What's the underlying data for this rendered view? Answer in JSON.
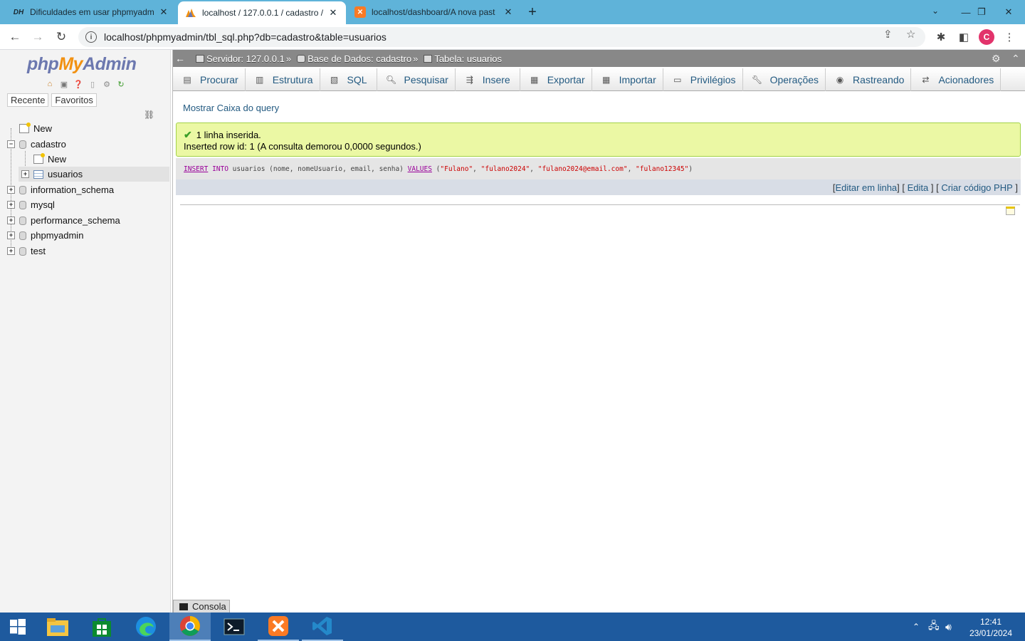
{
  "browser": {
    "tabs": [
      {
        "title": "Dificuldades em usar phpmyadm",
        "favicon": "DH",
        "active": false
      },
      {
        "title": "localhost / 127.0.0.1 / cadastro /",
        "favicon": "pma-icon",
        "active": true
      },
      {
        "title": "localhost/dashboard/A nova past",
        "favicon": "xampp-icon",
        "active": false
      }
    ],
    "url": "localhost/phpmyadmin/tbl_sql.php?db=cadastro&table=usuarios",
    "profile_initial": "C"
  },
  "pma": {
    "logo": {
      "php": "php",
      "my": "My",
      "admin": "Admin"
    },
    "left_tabs": [
      "Recente",
      "Favoritos"
    ],
    "tree": {
      "new_root": "New",
      "cadastro": "cadastro",
      "cadastro_new": "New",
      "usuarios": "usuarios",
      "information_schema": "information_schema",
      "mysql": "mysql",
      "performance_schema": "performance_schema",
      "phpmyadmin": "phpmyadmin",
      "test": "test"
    },
    "breadcrumb": {
      "server": "Servidor: 127.0.0.1",
      "database": "Base de Dados: cadastro",
      "table": "Tabela: usuarios"
    },
    "menu": [
      "Procurar",
      "Estrutura",
      "SQL",
      "Pesquisar",
      "Insere",
      "Exportar",
      "Importar",
      "Privilégios",
      "Operações",
      "Rastreando",
      "Acionadores"
    ],
    "show_query_box": "Mostrar Caixa do query",
    "success": {
      "line1": "1 linha inserida.",
      "line2": "Inserted row id: 1 (A consulta demorou 0,0000 segundos.)"
    },
    "sql": {
      "insert": "INSERT",
      "into": "INTO",
      "table_cols": " usuarios (nome, nomeUsuario, email, senha) ",
      "values": "VALUES",
      "open": " (",
      "v1": "\"Fulano\"",
      "v2": "\"fulano2024\"",
      "v3": "\"fulano2024@email.com\"",
      "v4": "\"fulano12345\"",
      "close": ")"
    },
    "sql_links": {
      "inline": "Editar em linha",
      "edit": "Edita",
      "php": "Criar código PHP"
    },
    "console": "Consola"
  },
  "taskbar": {
    "time": "12:41",
    "date": "23/01/2024"
  },
  "colors": {
    "tabstrip": "#5fb3d9",
    "taskbar": "#1e5a9e",
    "success_bg": "#ebf8a4",
    "link": "#235a81"
  }
}
